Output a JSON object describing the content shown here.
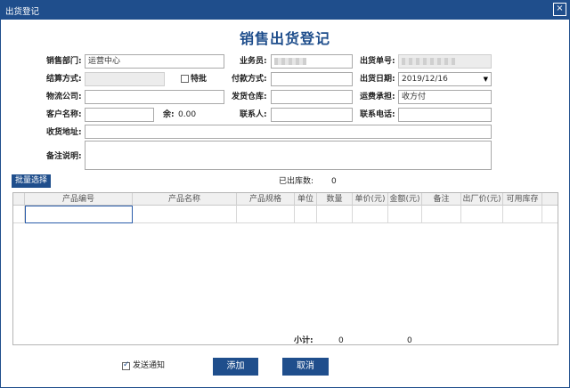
{
  "window": {
    "title": "出货登记",
    "close_glyph": "×"
  },
  "form": {
    "title": "销售出货登记",
    "sales_dept": {
      "label": "销售部门:",
      "value": "运营中心"
    },
    "salesperson": {
      "label": "业务员:"
    },
    "shipment_no": {
      "label": "出货单号:"
    },
    "settlement": {
      "label": "结算方式:",
      "value": ""
    },
    "special": {
      "label": "特批",
      "checked": false
    },
    "payment": {
      "label": "付款方式:",
      "value": ""
    },
    "ship_date": {
      "label": "出货日期:",
      "value": "2019/12/16",
      "dropdown_glyph": "▼"
    },
    "logistics": {
      "label": "物流公司:",
      "value": ""
    },
    "warehouse": {
      "label": "发货仓库:",
      "value": ""
    },
    "freight": {
      "label": "运费承担:",
      "value": "收方付"
    },
    "customer": {
      "label": "客户名称:",
      "value": ""
    },
    "balance": {
      "label": "余:",
      "value": "0.00"
    },
    "contact": {
      "label": "联系人:",
      "value": ""
    },
    "phone": {
      "label": "联系电话:",
      "value": ""
    },
    "address": {
      "label": "收货地址:",
      "value": ""
    },
    "remarks": {
      "label": "备注说明:",
      "value": ""
    }
  },
  "toolbar": {
    "batch_select": "批量选择",
    "stocked_label": "已出库数:",
    "stocked_value": "0"
  },
  "grid": {
    "columns": [
      "产品编号",
      "产品名称",
      "产品规格",
      "单位",
      "数量",
      "单价(元)",
      "金额(元)",
      "备注",
      "出厂价(元)",
      "可用库存"
    ]
  },
  "summary": {
    "label": "小计:",
    "quantity": "0",
    "amount": "0"
  },
  "footer": {
    "notify_label": "发送通知",
    "notify_checked": true,
    "add_label": "添加",
    "cancel_label": "取消"
  }
}
